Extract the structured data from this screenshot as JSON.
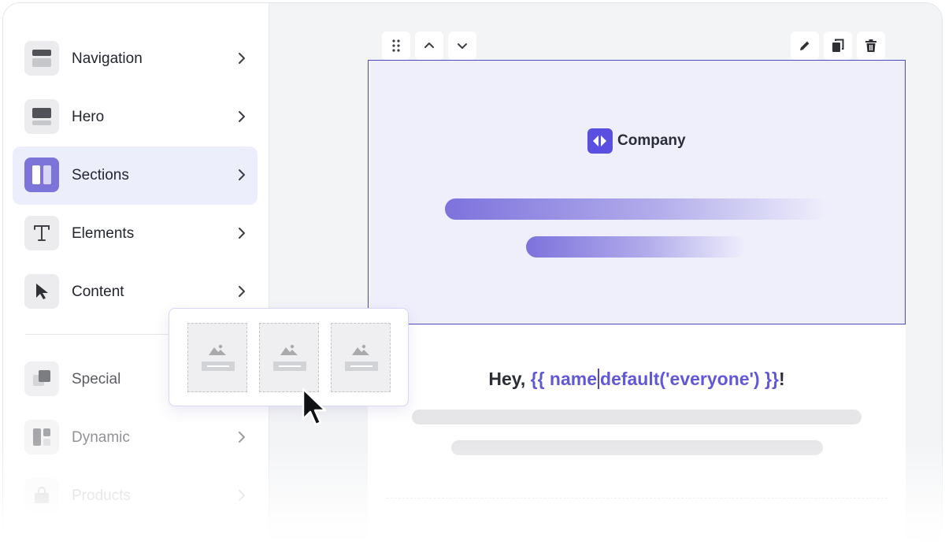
{
  "sidebar": {
    "items": [
      {
        "label": "Navigation",
        "icon": "navigation-block-icon"
      },
      {
        "label": "Hero",
        "icon": "hero-block-icon"
      },
      {
        "label": "Sections",
        "icon": "sections-columns-icon",
        "active": true
      },
      {
        "label": "Elements",
        "icon": "text-t-icon"
      },
      {
        "label": "Content",
        "icon": "pointer-arrow-icon"
      },
      {
        "label": "Special",
        "icon": "special-layers-icon"
      },
      {
        "label": "Dynamic",
        "icon": "dynamic-grid-icon"
      },
      {
        "label": "Products",
        "icon": "shopping-bag-icon"
      }
    ]
  },
  "section_popup": {
    "layouts": [
      "one-column-image-layout",
      "one-column-image-layout",
      "one-column-image-layout"
    ]
  },
  "toolbar": {
    "left": [
      "drag-handle-icon",
      "move-up-icon",
      "move-down-icon"
    ],
    "right": [
      "edit-pencil-icon",
      "duplicate-icon",
      "delete-trash-icon"
    ]
  },
  "email": {
    "brand_name": "Company",
    "greeting_prefix": "Hey, ",
    "greeting_var_1": "{{ name",
    "greeting_var_2": "default('everyone') }}",
    "greeting_suffix": "!"
  },
  "colors": {
    "accent": "#7c74d8",
    "selection_border": "#4f49c0",
    "hero_background": "#efeffc",
    "variable_text": "#6158d8"
  }
}
